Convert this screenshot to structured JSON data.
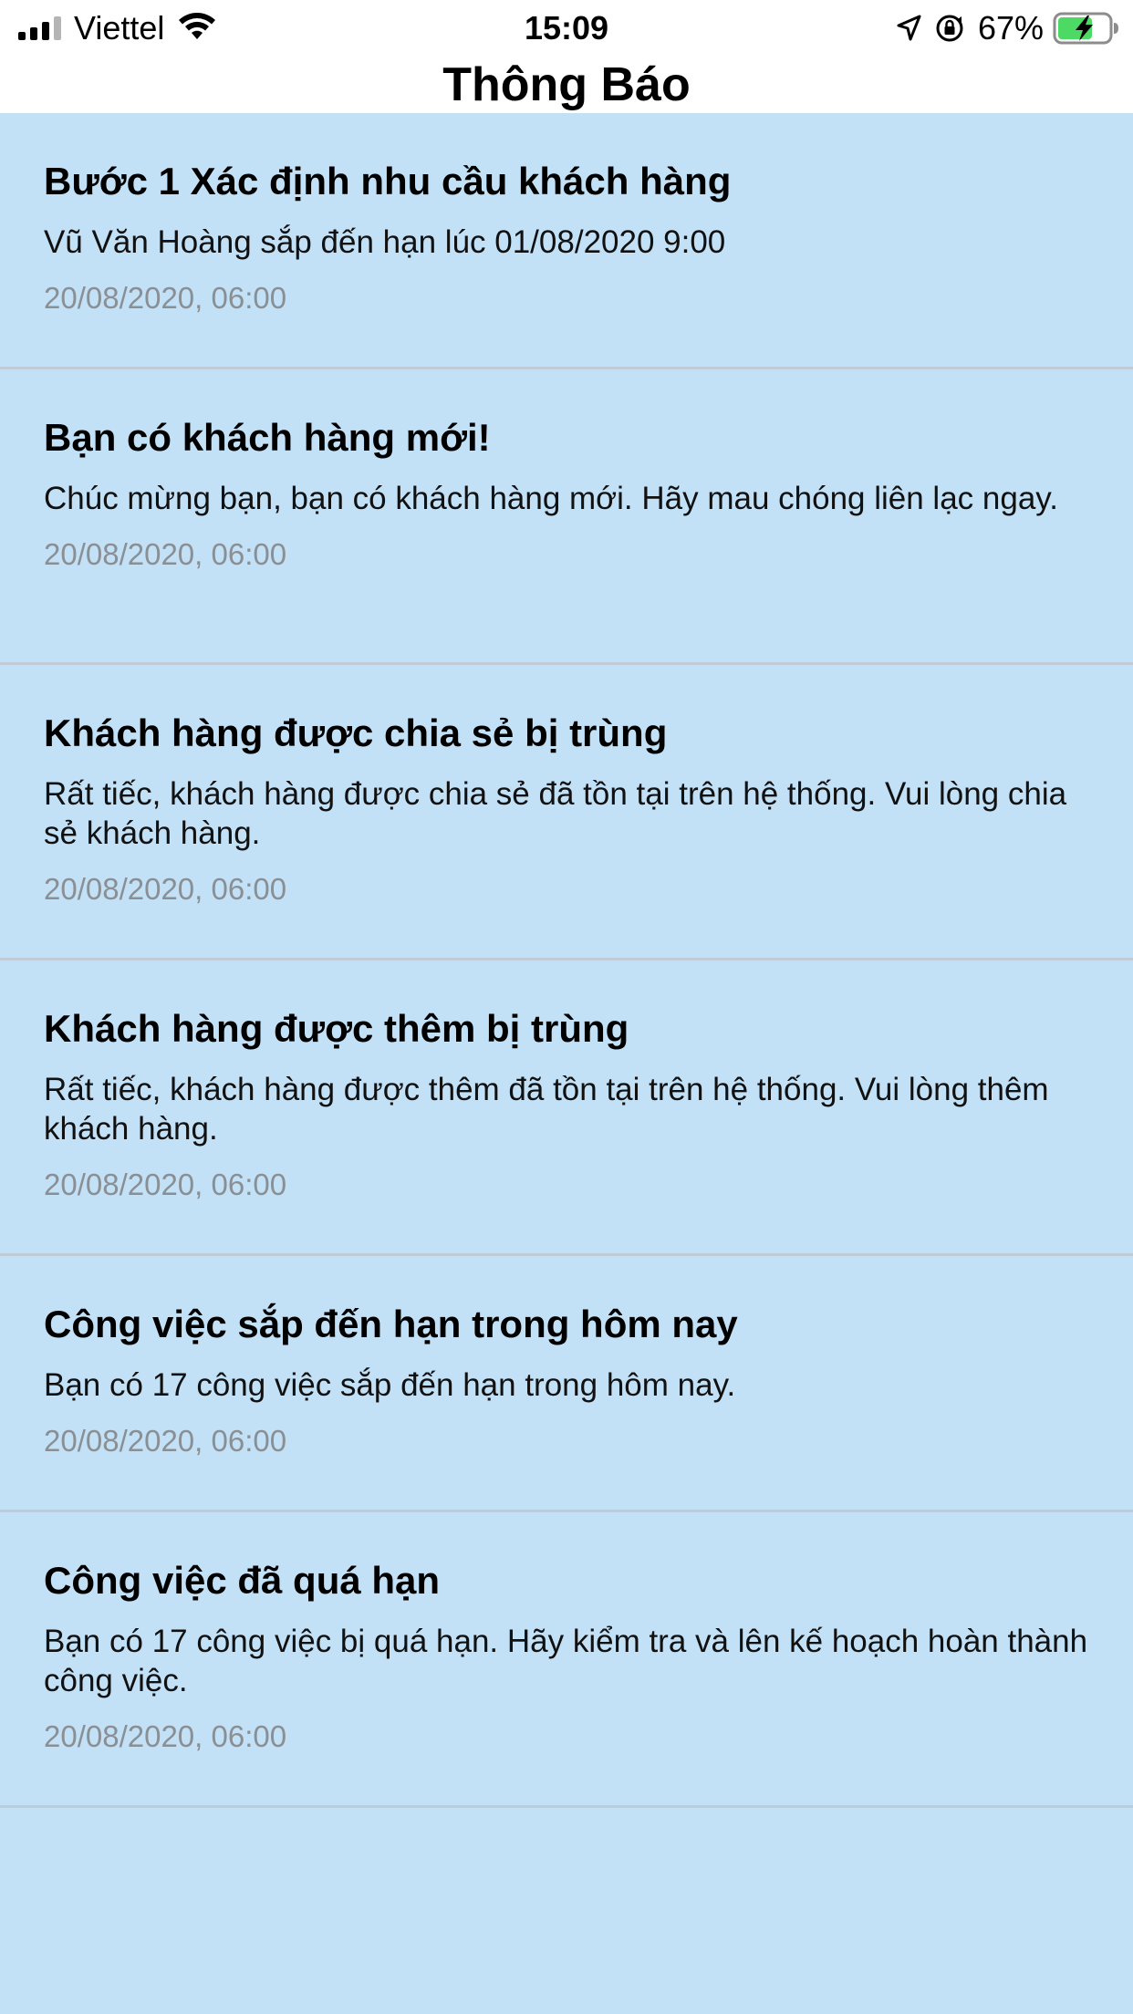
{
  "status_bar": {
    "carrier": "Viettel",
    "time": "15:09",
    "battery_percent": "67%",
    "signal_bars_active": 3,
    "signal_bars_total": 4,
    "icons": [
      "signal-icon",
      "wifi-icon",
      "location-icon",
      "rotation-lock-icon",
      "battery-charging-icon"
    ]
  },
  "header": {
    "title": "Thông Báo"
  },
  "notifications": [
    {
      "title": "Bước 1 Xác định nhu cầu khách hàng",
      "body": "Vũ Văn Hoàng sắp đến hạn lúc 01/08/2020 9:00",
      "time": "20/08/2020, 06:00"
    },
    {
      "title": "Bạn có khách hàng mới!",
      "body": "Chúc mừng bạn, bạn có khách hàng mới. Hãy mau chóng liên lạc ngay.",
      "time": "20/08/2020, 06:00"
    },
    {
      "title": "Khách hàng được chia sẻ bị trùng",
      "body": "Rất tiếc, khách hàng được chia sẻ đã tồn tại trên hệ thống. Vui lòng chia sẻ khách hàng.",
      "time": "20/08/2020, 06:00"
    },
    {
      "title": "Khách hàng được thêm bị trùng",
      "body": "Rất tiếc, khách hàng được thêm đã tồn tại trên hệ thống. Vui lòng thêm khách hàng.",
      "time": "20/08/2020, 06:00"
    },
    {
      "title": "Công việc sắp đến hạn trong hôm nay",
      "body": "Bạn có 17 công việc sắp đến hạn trong hôm nay.",
      "time": "20/08/2020, 06:00"
    },
    {
      "title": "Công việc đã quá hạn",
      "body": "Bạn có 17 công việc bị quá hạn. Hãy kiểm tra và lên kế hoạch hoàn thành công việc.",
      "time": "20/08/2020, 06:00"
    }
  ],
  "colors": {
    "list_background": "#C2E1F7",
    "header_background": "#FFFFFF",
    "separator": "#BFCBD6",
    "timestamp": "#8A8F94",
    "battery_fill": "#4CD964"
  }
}
